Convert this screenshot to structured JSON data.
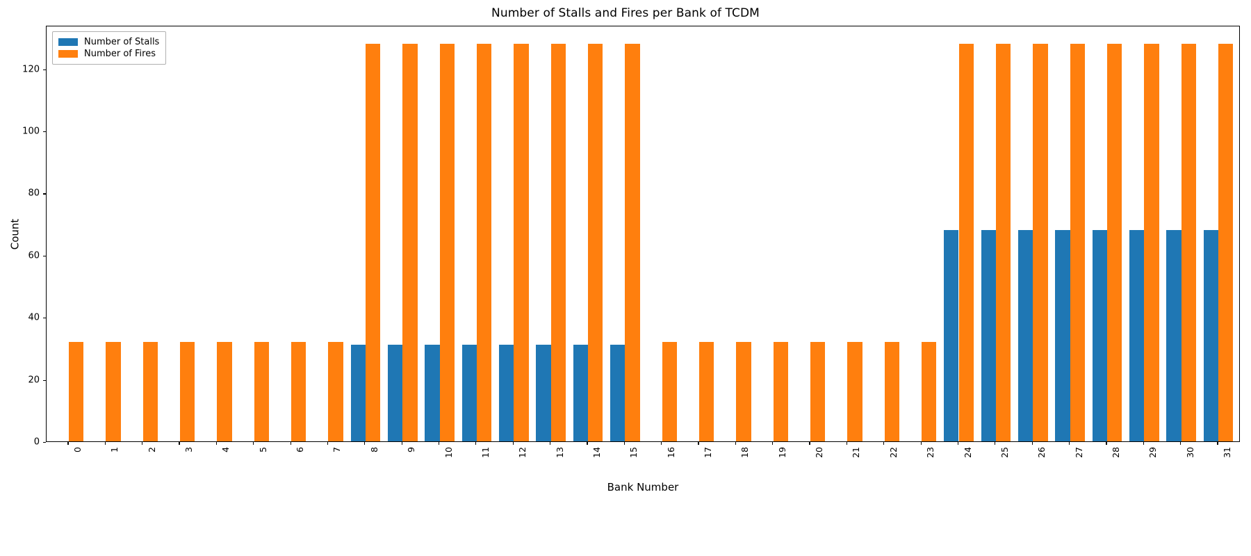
{
  "chart_data": {
    "type": "bar",
    "title": "Number of Stalls and Fires per Bank of TCDM",
    "xlabel": "Bank Number",
    "ylabel": "Count",
    "grid": false,
    "legend_position": "upper left",
    "xlim": [
      -0.6,
      31.6
    ],
    "ylim": [
      0,
      134
    ],
    "ytick_labels": [
      "0",
      "20",
      "40",
      "60",
      "80",
      "100",
      "120"
    ],
    "yticks": [
      0,
      20,
      40,
      60,
      80,
      100,
      120
    ],
    "categories": [
      "0",
      "1",
      "2",
      "3",
      "4",
      "5",
      "6",
      "7",
      "8",
      "9",
      "10",
      "11",
      "12",
      "13",
      "14",
      "15",
      "16",
      "17",
      "18",
      "19",
      "20",
      "21",
      "22",
      "23",
      "24",
      "25",
      "26",
      "27",
      "28",
      "29",
      "30",
      "31"
    ],
    "xtick_rotation": -90,
    "series": [
      {
        "name": "Number of Stalls",
        "color": "#1f77b4",
        "values": [
          0,
          0,
          0,
          0,
          0,
          0,
          0,
          0,
          31,
          31,
          31,
          31,
          31,
          31,
          31,
          31,
          0,
          0,
          0,
          0,
          0,
          0,
          0,
          0,
          68,
          68,
          68,
          68,
          68,
          68,
          68,
          68
        ]
      },
      {
        "name": "Number of Fires",
        "color": "#ff7f0e",
        "values": [
          32,
          32,
          32,
          32,
          32,
          32,
          32,
          32,
          128,
          128,
          128,
          128,
          128,
          128,
          128,
          128,
          32,
          32,
          32,
          32,
          32,
          32,
          32,
          32,
          128,
          128,
          128,
          128,
          128,
          128,
          128,
          128
        ]
      }
    ]
  },
  "legend": {
    "entries": [
      {
        "label": "Number of Stalls",
        "color": "#1f77b4"
      },
      {
        "label": "Number of Fires",
        "color": "#ff7f0e"
      }
    ]
  },
  "figure": {
    "background": "#ffffff",
    "axes_edge_color": "#000000",
    "text_color": "#000000"
  }
}
